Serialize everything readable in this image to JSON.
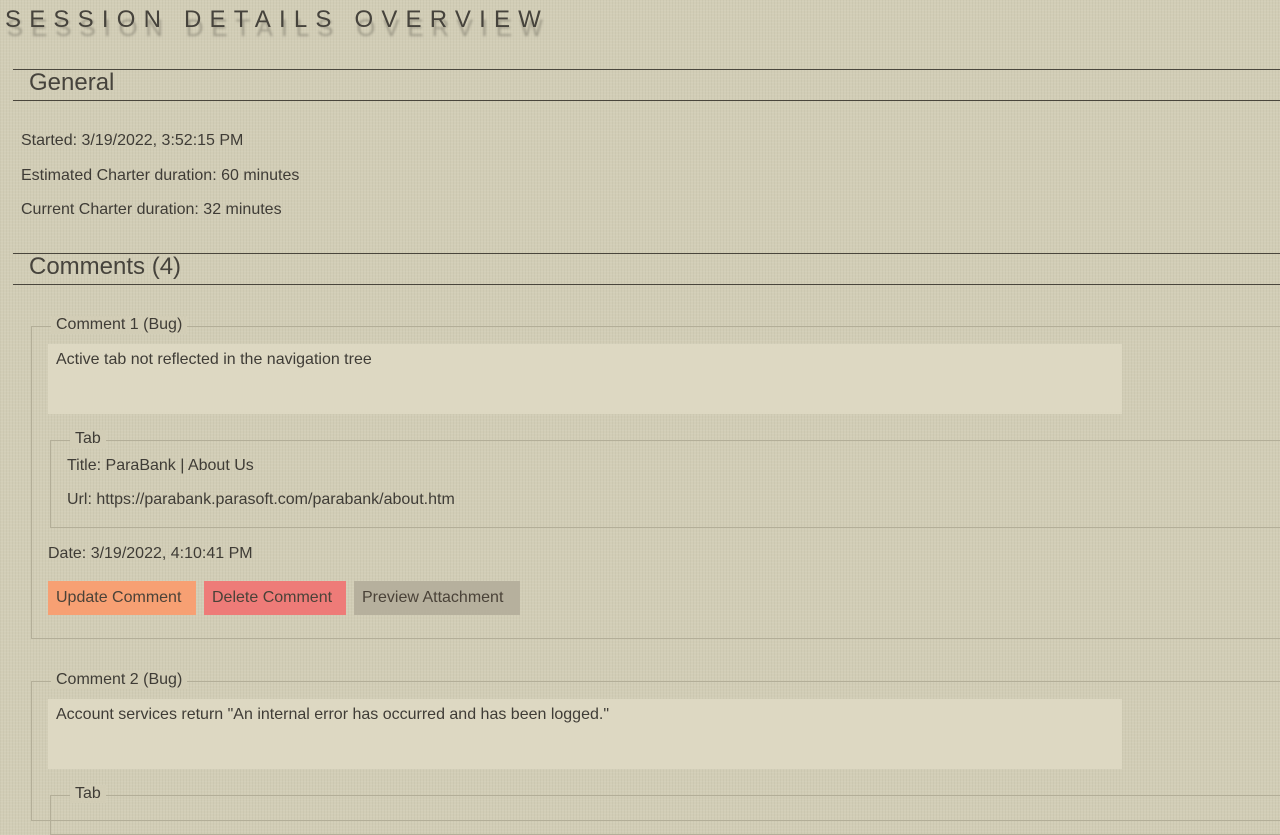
{
  "page": {
    "title": "SESSION DETAILS OVERVIEW"
  },
  "general": {
    "heading": "General",
    "started": "Started: 3/19/2022, 3:52:15 PM",
    "estimated_duration": "Estimated Charter duration: 60 minutes",
    "current_duration": "Current Charter duration: 32 minutes"
  },
  "comments_section": {
    "heading": "Comments (4)"
  },
  "comments": [
    {
      "legend": "Comment 1 (Bug)",
      "text": "Active tab not reflected in the navigation tree",
      "tab_legend": "Tab",
      "tab_title": "Title: ParaBank | About Us",
      "tab_url": "Url: https://parabank.parasoft.com/parabank/about.htm",
      "date": "Date: 3/19/2022, 4:10:41 PM",
      "buttons": {
        "update": "Update Comment",
        "delete": "Delete Comment",
        "preview": "Preview Attachment"
      }
    },
    {
      "legend": "Comment 2 (Bug)",
      "text": "Account services return \"An internal error has occurred and has been logged.\"",
      "tab_legend": "Tab"
    }
  ],
  "colors": {
    "background": "#d2cdb6",
    "text": "#3f3c36",
    "textarea": "#ddd8c2",
    "update_button": "#f7a073",
    "delete_button": "#ee7b78",
    "preview_button": "#b6b09d"
  }
}
